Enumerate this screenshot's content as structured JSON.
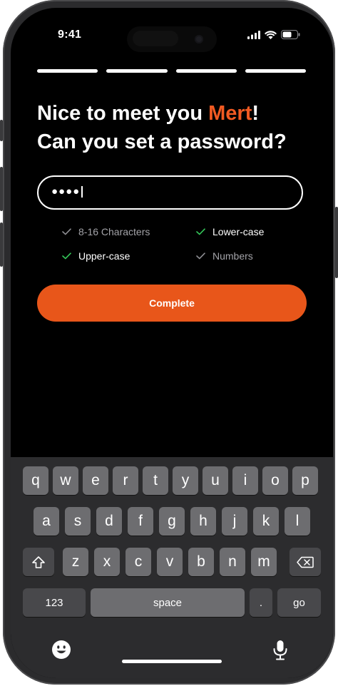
{
  "status_bar": {
    "time": "9:41"
  },
  "progress": {
    "total_steps": 4,
    "completed_steps": 4
  },
  "heading": {
    "line1_prefix": "Nice to meet you ",
    "name": "Mert",
    "line1_suffix": "!",
    "line2": "Can you set a password?"
  },
  "password_field": {
    "masked_value": "●●●●"
  },
  "rules": [
    {
      "label": "8-16 Characters",
      "met": false
    },
    {
      "label": "Lower-case",
      "met": true
    },
    {
      "label": "Upper-case",
      "met": true
    },
    {
      "label": "Numbers",
      "met": false
    }
  ],
  "complete_button": {
    "label": "Complete"
  },
  "keyboard": {
    "row1": [
      "q",
      "w",
      "e",
      "r",
      "t",
      "y",
      "u",
      "i",
      "o",
      "p"
    ],
    "row2": [
      "a",
      "s",
      "d",
      "f",
      "g",
      "h",
      "j",
      "k",
      "l"
    ],
    "row3": [
      "z",
      "x",
      "c",
      "v",
      "b",
      "n",
      "m"
    ],
    "numbers_key": "123",
    "space_key": "space",
    "period_key": ".",
    "go_key": "go"
  },
  "colors": {
    "accent": "#f15a22",
    "button": "#e8561a",
    "check_met": "#34c759",
    "check_unmet": "#8e8e93"
  }
}
